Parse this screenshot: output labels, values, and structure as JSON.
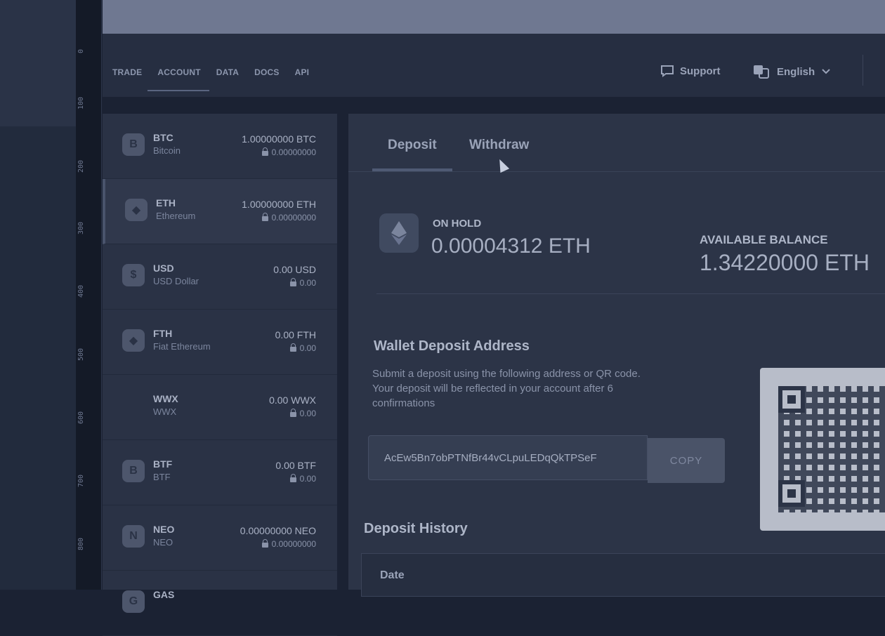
{
  "ruler": {
    "ticks": [
      "0",
      "100",
      "200",
      "300",
      "400",
      "500",
      "600",
      "700",
      "800"
    ]
  },
  "nav": {
    "items": [
      "TRADE",
      "ACCOUNT",
      "DATA",
      "DOCS",
      "API"
    ],
    "active": "ACCOUNT"
  },
  "header": {
    "support_label": "Support",
    "language_label": "English",
    "support_icon": "chat-bubble-icon",
    "language_icon": "translate-icon"
  },
  "assets": [
    {
      "symbol": "BTC",
      "name": "Bitcoin",
      "amount": "1.00000000 BTC",
      "hold": "0.00000000",
      "icon": "B"
    },
    {
      "symbol": "ETH",
      "name": "Ethereum",
      "amount": "1.00000000 ETH",
      "hold": "0.00000000",
      "icon": "◆"
    },
    {
      "symbol": "USD",
      "name": "USD Dollar",
      "amount": "0.00 USD",
      "hold": "0.00",
      "icon": "$"
    },
    {
      "symbol": "FTH",
      "name": "Fiat Ethereum",
      "amount": "0.00 FTH",
      "hold": "0.00",
      "icon": "◆"
    },
    {
      "symbol": "WWX",
      "name": "WWX",
      "amount": "0.00 WWX",
      "hold": "0.00",
      "icon": ""
    },
    {
      "symbol": "BTF",
      "name": "BTF",
      "amount": "0.00 BTF",
      "hold": "0.00",
      "icon": "B"
    },
    {
      "symbol": "NEO",
      "name": "NEO",
      "amount": "0.00000000 NEO",
      "hold": "0.00000000",
      "icon": "N"
    },
    {
      "symbol": "GAS",
      "name": "",
      "amount": "",
      "hold": "",
      "icon": "G"
    }
  ],
  "main": {
    "tabs": {
      "deposit": "Deposit",
      "withdraw": "Withdraw"
    },
    "on_hold_label": "ON HOLD",
    "on_hold_value": "0.00004312 ETH",
    "available_label": "AVAILABLE BALANCE",
    "available_value": "1.34220000 ETH",
    "wallet_title": "Wallet Deposit Address",
    "wallet_desc": "Submit a deposit using the following address or QR code. Your deposit will be reflected in your account after 6 confirmations",
    "address": "AcEw5Bn7obPTNfBr44vCLpuLEDqQkTPSeF",
    "copy_label": "COPY",
    "history_title": "Deposit History",
    "history_columns": {
      "date": "Date"
    }
  },
  "colors": {
    "background": "#1b2233",
    "panel": "#2c3447",
    "sidebar": "#2a3245",
    "topbar": "#6f7891"
  }
}
